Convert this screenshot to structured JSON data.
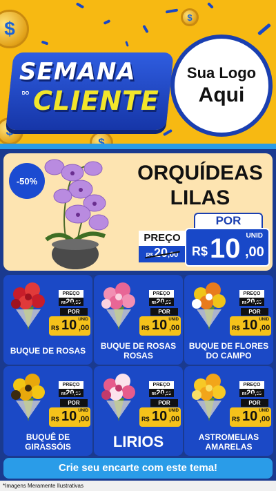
{
  "header": {
    "title_line1": "SEMANA",
    "title_do": "DO",
    "title_line2": "CLIENTE",
    "logo_line1": "Sua Logo",
    "logo_line2": "Aqui"
  },
  "featured": {
    "discount": "-50%",
    "name_line1": "ORQUÍDEAS",
    "name_line2": "LILAS",
    "preco_label": "PREÇO",
    "old_currency": "R$",
    "old_int": "20",
    "old_dec": ",00",
    "por_label": "POR",
    "unit_label": "UNID",
    "new_currency": "R$",
    "new_int": "10",
    "new_dec": ",00"
  },
  "products": [
    {
      "name": "BUQUE DE ROSAS",
      "preco_label": "PREÇO",
      "old_currency": "R$",
      "old_int": "20",
      "old_dec": ",00",
      "por_label": "POR",
      "unit_label": "UNID",
      "new_currency": "R$",
      "new_int": "10",
      "new_dec": ",00",
      "icon": "red-roses-bouquet-icon"
    },
    {
      "name": "BUQUE DE ROSAS ROSAS",
      "preco_label": "PREÇO",
      "old_currency": "R$",
      "old_int": "20",
      "old_dec": ",00",
      "por_label": "POR",
      "unit_label": "UNID",
      "new_currency": "R$",
      "new_int": "10",
      "new_dec": ",00",
      "icon": "pink-roses-bouquet-icon"
    },
    {
      "name": "BUQUE DE FLORES DO CAMPO",
      "preco_label": "PREÇO",
      "old_currency": "R$",
      "old_int": "20",
      "old_dec": ",00",
      "por_label": "POR",
      "unit_label": "UNID",
      "new_currency": "R$",
      "new_int": "10",
      "new_dec": ",00",
      "icon": "wildflowers-bouquet-icon"
    },
    {
      "name": "BUQUÊ DE GIRASSÓIS",
      "preco_label": "PREÇO",
      "old_currency": "R$",
      "old_int": "20",
      "old_dec": ",00",
      "por_label": "POR",
      "unit_label": "UNID",
      "new_currency": "R$",
      "new_int": "10",
      "new_dec": ",00",
      "icon": "sunflowers-bouquet-icon"
    },
    {
      "name": "LIRIOS",
      "preco_label": "PREÇO",
      "old_currency": "R$",
      "old_int": "20",
      "old_dec": ",00",
      "por_label": "POR",
      "unit_label": "UNID",
      "new_currency": "R$",
      "new_int": "10",
      "new_dec": ",00",
      "icon": "lilies-bouquet-icon"
    },
    {
      "name": "ASTROMELIAS AMARELAS",
      "preco_label": "PREÇO",
      "old_currency": "R$",
      "old_int": "20",
      "old_dec": ",00",
      "por_label": "POR",
      "unit_label": "UNID",
      "new_currency": "R$",
      "new_int": "10",
      "new_dec": ",00",
      "icon": "yellow-alstroemeria-bouquet-icon"
    }
  ],
  "cta": "Crie seu encarte com este tema!",
  "disclaimer": "*Imagens Meramente Ilustrativas",
  "colors": {
    "header_bg": "#f7b912",
    "brand_blue": "#1848c8",
    "accent_sky": "#2a9ce8",
    "price_yellow": "#f5c21a",
    "featured_bg": "#fde4b1"
  }
}
